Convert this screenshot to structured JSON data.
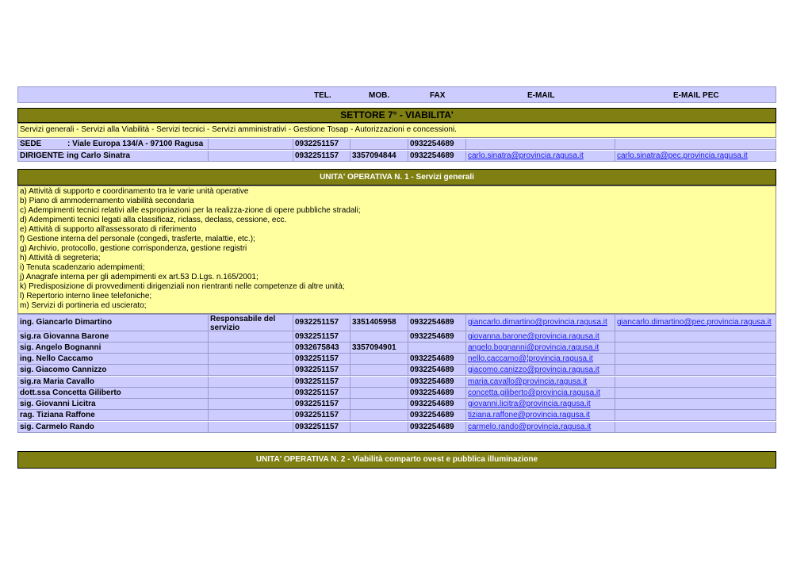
{
  "columns": {
    "tel": "TEL.",
    "mob": "MOB.",
    "fax": "FAX",
    "email": "E-MAIL",
    "email_pec": "E-MAIL PEC"
  },
  "settore": {
    "title": "SETTORE 7° - VIABILITA'",
    "description": "Servizi generali - Servizi alla Viabilità - Servizi tecnici - Servizi amministrativi - Gestione Tosap - Autorizzazioni e concessioni.",
    "sede": {
      "label": "SEDE",
      "value": ": Viale Europa 134/A - 97100 Ragusa",
      "tel": "0932251157",
      "fax": "0932254689"
    },
    "dirigente": {
      "label": "DIRIGENTE",
      "value": ": ing Carlo Sinatra",
      "tel": "0932251157",
      "mob": "3357094844",
      "fax": "0932254689",
      "email": "carlo.sinatra@provincia.ragusa.it",
      "email_pec": "carlo.sinatra@pec.provincia.ragusa.it"
    }
  },
  "uo1": {
    "title": "UNITA' OPERATIVA N. 1 - Servizi generali",
    "duties": [
      "a) Attività di supporto e coordinamento tra le varie unità operative",
      "b) Piano di ammodernamento viabilità secondaria",
      "c) Adempimenti tecnici relativi alle espropriazioni per la realizza-zione di opere pubbliche stradali;",
      "d) Adempimenti tecnici legati alla classificaz, riclass, declass, cessione, ecc.",
      "e) Attività di supporto all'assessorato di riferimento",
      "f) Gestione interna del personale (congedi, trasferte, malattie, etc.);",
      "g) Archivio, protocollo, gestione corrispondenza, gestione registri",
      "h) Attività di segreteria;",
      "i) Tenuta scadenzario adempimenti;",
      "j) Anagrafe interna per gli adempimenti ex art.53 D.Lgs. n.165/2001;",
      "k) Predisposizione di provvedimenti dirigenziali non rientranti nelle competenze di altre unità;",
      "l) Repertorio interno linee telefoniche;",
      "m) Servizi di portineria ed uscierato;"
    ],
    "staff": [
      {
        "name": "ing. Giancarlo Dimartino",
        "role": "Responsabile del servizio",
        "tel": "0932251157",
        "mob": "3351405958",
        "fax": "0932254689",
        "email": "giancarlo.dimartino@provincia.ragusa.it",
        "email_pec": "giancarlo.dimartino@pec.provincia.ragusa.it"
      },
      {
        "name": "sig.ra Giovanna Barone",
        "role": "",
        "tel": "0932251157",
        "mob": "",
        "fax": "0932254689",
        "email": "giovanna.barone@provincia.ragusa.it",
        "email_pec": ""
      },
      {
        "name": "sig. Angelo Bognanni",
        "role": "",
        "tel": "0932675843",
        "mob": "3357094901",
        "fax": "",
        "email": "angelo.bognanni@provincia.ragusa.it",
        "email_pec": ""
      },
      {
        "name": "ing. Nello Caccamo",
        "role": "",
        "tel": "0932251157",
        "mob": "",
        "fax": "0932254689",
        "email": "nello.caccamo@¦provincia.ragusa.it",
        "email_pec": ""
      },
      {
        "name": "sig. Giacomo Cannizzo",
        "role": "",
        "tel": "0932251157",
        "mob": "",
        "fax": "0932254689",
        "email": "giacomo.canizzo@provincia.ragusa.it",
        "email_pec": ""
      },
      {
        "name": "sig.ra Maria Cavallo",
        "role": "",
        "tel": "0932251157",
        "mob": "",
        "fax": "0932254689",
        "email": "maria.cavallo@provincia.ragusa.it",
        "email_pec": ""
      },
      {
        "name": "dott.ssa Concetta Giliberto",
        "role": "",
        "tel": "0932251157",
        "mob": "",
        "fax": "0932254689",
        "email": "concetta.giliberto@provincia.ragusa.it",
        "email_pec": ""
      },
      {
        "name": "sig. Giovanni Licitra",
        "role": "",
        "tel": "0932251157",
        "mob": "",
        "fax": "0932254689",
        "email": "giovanni.licitra@provincia.ragusa.it",
        "email_pec": ""
      },
      {
        "name": "rag. Tiziana Raffone",
        "role": "",
        "tel": "0932251157",
        "mob": "",
        "fax": "0932254689",
        "email": "tiziana.raffone@provincia.ragusa.it",
        "email_pec": ""
      },
      {
        "name": "sig. Carmelo Rando",
        "role": "",
        "tel": "0932251157",
        "mob": "",
        "fax": "0932254689",
        "email": "carmelo.rando@provincia.ragusa.it",
        "email_pec": ""
      }
    ]
  },
  "uo2": {
    "title": "UNITA' OPERATIVA N. 2 - Viabilità comparto ovest e pubblica illuminazione"
  }
}
